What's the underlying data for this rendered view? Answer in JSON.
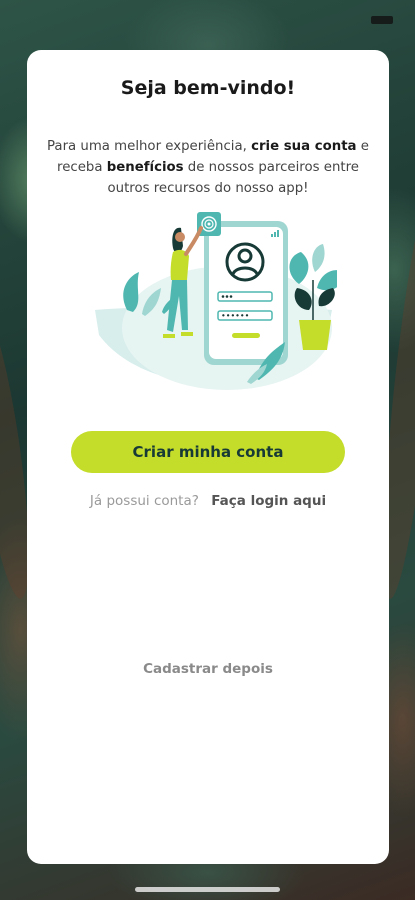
{
  "welcome": {
    "title": "Seja bem-vindo!",
    "desc_part1": "Para uma melhor experiência, ",
    "desc_bold1": "crie sua conta",
    "desc_part2": " e receba ",
    "desc_bold2": "benefícios",
    "desc_part3": " de nossos parceiros entre outros recursos do nosso app!"
  },
  "illustration": {
    "password_mask": "••••••"
  },
  "actions": {
    "create_account_label": "Criar minha conta",
    "has_account_text": "Já possui conta?",
    "login_link_label": "Faça login aqui",
    "later_label": "Cadastrar depois"
  },
  "colors": {
    "accent": "#c4dc2a",
    "teal": "#4fb7b0",
    "dark_teal": "#173a36"
  },
  "icons": [
    "user-avatar-icon",
    "fingerprint-icon",
    "signal-bars-icon"
  ]
}
